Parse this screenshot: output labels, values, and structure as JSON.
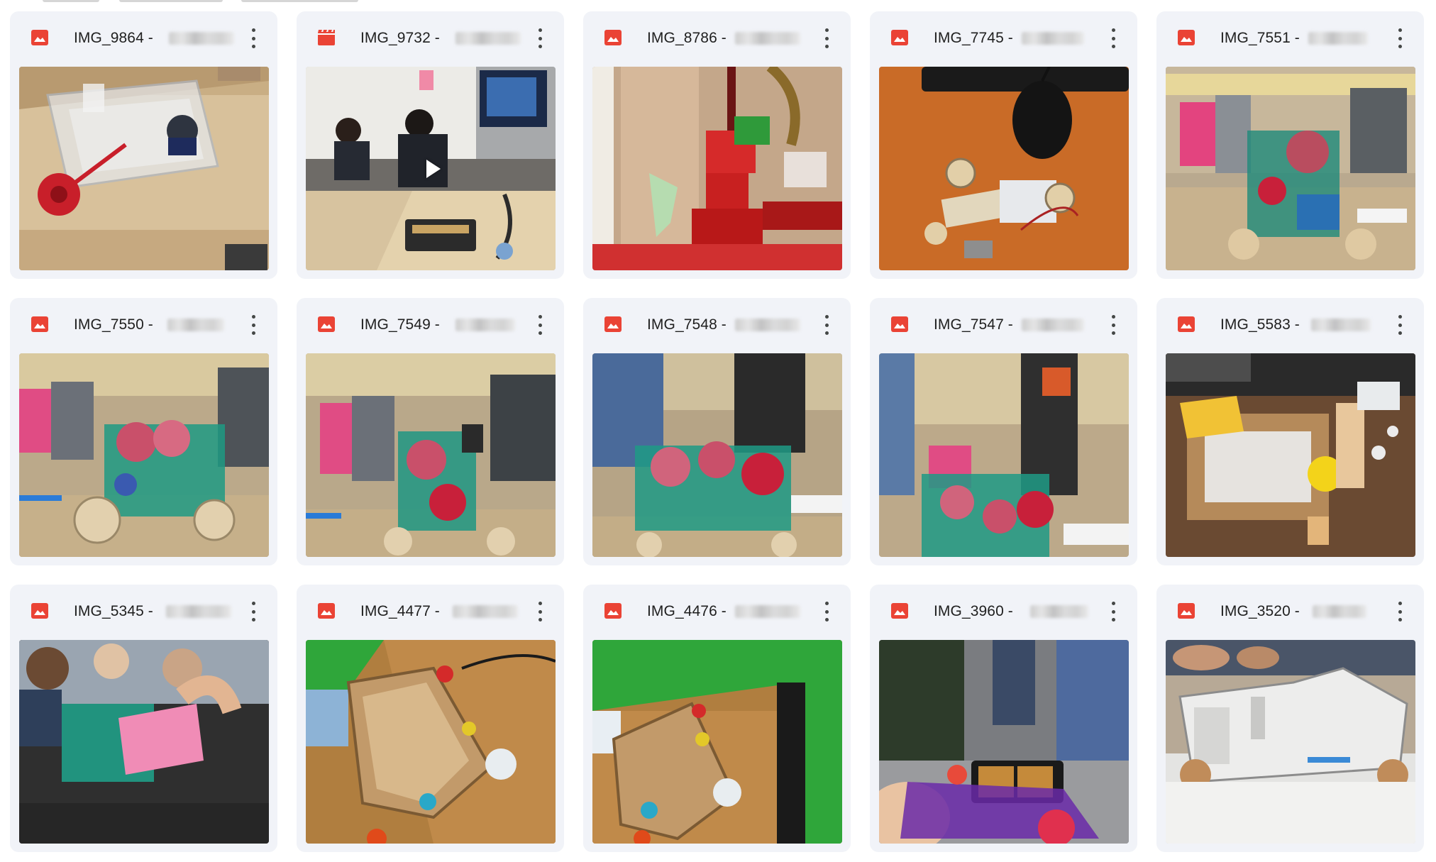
{
  "grid": {
    "files": [
      {
        "name": "IMG_9864 -",
        "type": "image",
        "type_icon": "image-file-icon"
      },
      {
        "name": "IMG_9732 -",
        "type": "video",
        "type_icon": "video-file-icon"
      },
      {
        "name": "IMG_8786 -",
        "type": "image",
        "type_icon": "image-file-icon"
      },
      {
        "name": "IMG_7745 -",
        "type": "image",
        "type_icon": "image-file-icon"
      },
      {
        "name": "IMG_7551 -",
        "type": "image",
        "type_icon": "image-file-icon"
      },
      {
        "name": "IMG_7550 -",
        "type": "image",
        "type_icon": "image-file-icon"
      },
      {
        "name": "IMG_7549 -",
        "type": "image",
        "type_icon": "image-file-icon"
      },
      {
        "name": "IMG_7548 -",
        "type": "image",
        "type_icon": "image-file-icon"
      },
      {
        "name": "IMG_7547 -",
        "type": "image",
        "type_icon": "image-file-icon"
      },
      {
        "name": "IMG_5583 -",
        "type": "image",
        "type_icon": "image-file-icon"
      },
      {
        "name": "IMG_5345 -",
        "type": "image",
        "type_icon": "image-file-icon"
      },
      {
        "name": "IMG_4477 -",
        "type": "image",
        "type_icon": "image-file-icon"
      },
      {
        "name": "IMG_4476 -",
        "type": "image",
        "type_icon": "image-file-icon"
      },
      {
        "name": "IMG_3960 -",
        "type": "image",
        "type_icon": "image-file-icon"
      },
      {
        "name": "IMG_3520 -",
        "type": "image",
        "type_icon": "image-file-icon"
      }
    ]
  },
  "colors": {
    "image_icon": "#ea4335",
    "video_icon": "#ea4335",
    "tile_bg": "#f1f3f8",
    "more_dots": "#444746"
  },
  "icons": {
    "more": "more-vert-icon",
    "play": "play-icon"
  }
}
